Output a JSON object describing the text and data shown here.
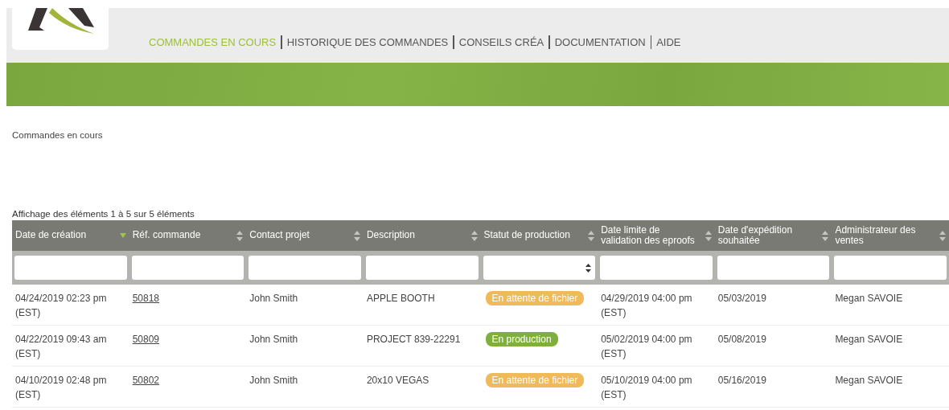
{
  "nav": [
    {
      "label": "COMMANDES EN COURS",
      "selected": true
    },
    {
      "label": "HISTORIQUE DES COMMANDES",
      "selected": false
    },
    {
      "label": "CONSEILS CRÉA",
      "selected": false
    },
    {
      "label": "DOCUMENTATION",
      "selected": false
    },
    {
      "label": "AIDE",
      "selected": false
    }
  ],
  "page_title": "Commandes en cours",
  "table": {
    "caption": "Affichage des éléments 1 à 5 sur 5 éléments",
    "columns": [
      {
        "label": "Date de création",
        "sorted": true,
        "kind": "text"
      },
      {
        "label": "Réf. commande",
        "sorted": false,
        "kind": "text"
      },
      {
        "label": "Contact projet",
        "sorted": false,
        "kind": "text"
      },
      {
        "label": "Description",
        "sorted": false,
        "kind": "text"
      },
      {
        "label": "Statut de production",
        "sorted": false,
        "kind": "select"
      },
      {
        "label": "Date limite de validation des eproofs",
        "sorted": false,
        "kind": "text"
      },
      {
        "label": "Date d'expédition souhaitée",
        "sorted": false,
        "kind": "text"
      },
      {
        "label": "Administrateur des ventes",
        "sorted": false,
        "kind": "text"
      }
    ],
    "rows": [
      {
        "created": "04/24/2019 02:23 pm (EST)",
        "ref": "50818",
        "contact": "John Smith",
        "description": "APPLE BOOTH",
        "status": {
          "label": "En attente de fichier",
          "color": "#f0b95a"
        },
        "deadline": "04/29/2019 04:00 pm (EST)",
        "ship": "05/03/2019",
        "admin": "Megan SAVOIE"
      },
      {
        "created": "04/22/2019 09:43 am (EST)",
        "ref": "50809",
        "contact": "John Smith",
        "description": "PROJECT 839-22291",
        "status": {
          "label": "En production",
          "color": "#7fb03e"
        },
        "deadline": "05/02/2019 04:00 pm (EST)",
        "ship": "05/08/2019",
        "admin": "Megan SAVOIE"
      },
      {
        "created": "04/10/2019 02:48 pm (EST)",
        "ref": "50802",
        "contact": "John Smith",
        "description": "20x10 VEGAS",
        "status": {
          "label": "En attente de fichier",
          "color": "#f0b95a"
        },
        "deadline": "05/10/2019 04:00 pm (EST)",
        "ship": "05/16/2019",
        "admin": "Megan SAVOIE"
      }
    ]
  }
}
